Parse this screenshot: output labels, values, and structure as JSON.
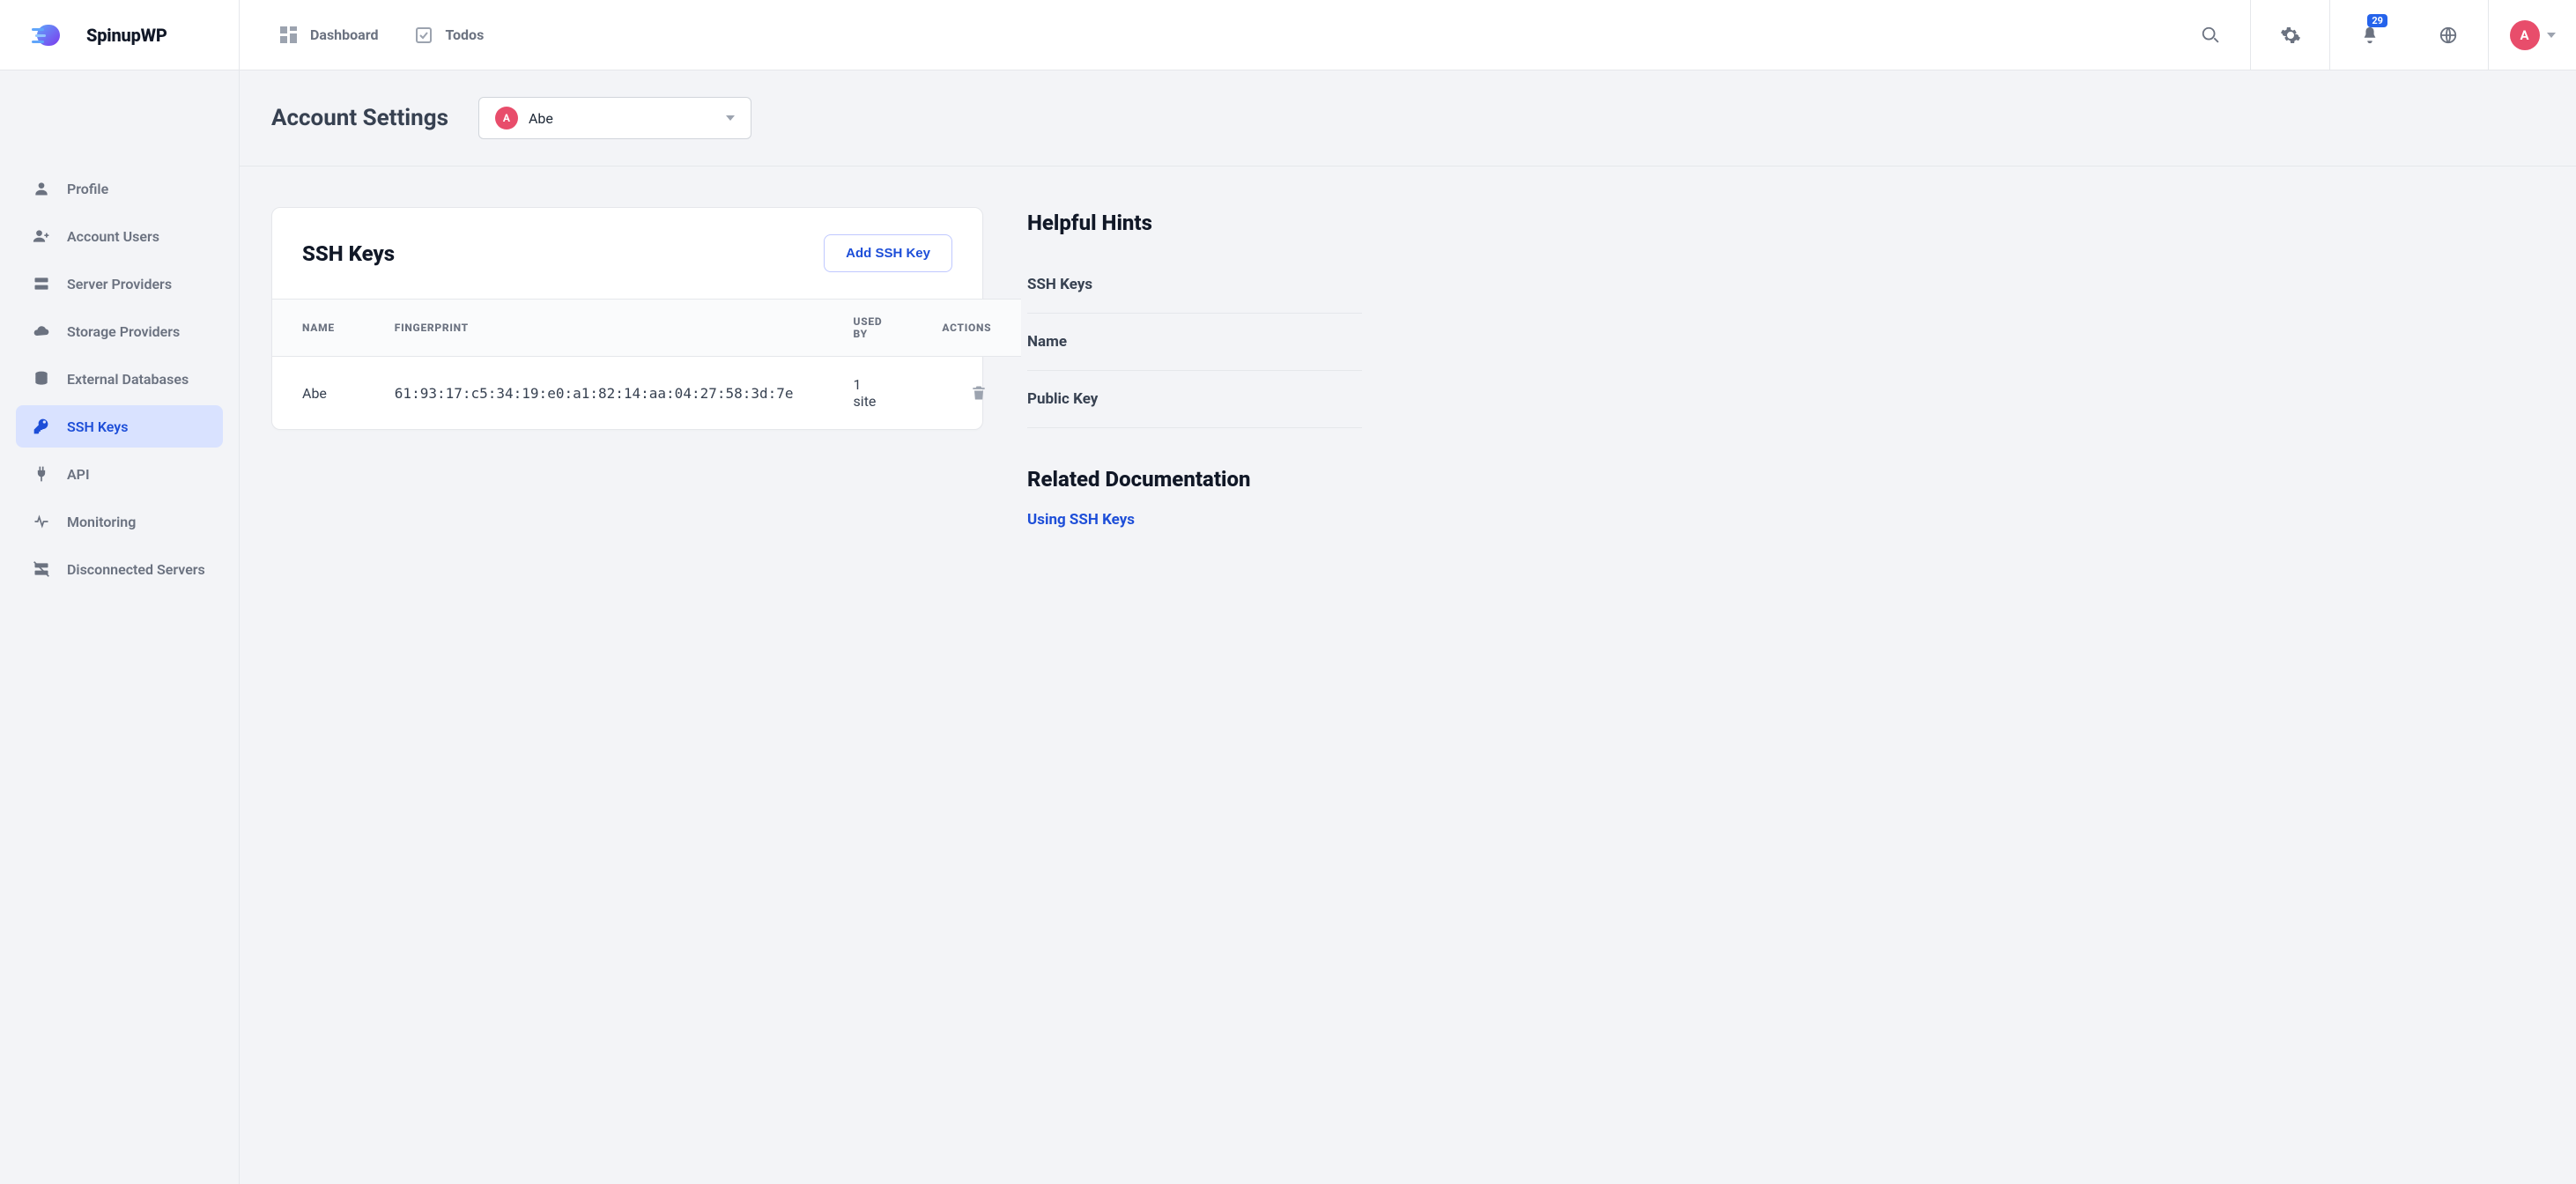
{
  "brand": {
    "name": "SpinupWP"
  },
  "topnav": {
    "dashboard": "Dashboard",
    "todos": "Todos"
  },
  "notifications": {
    "count": "29"
  },
  "user": {
    "initial": "A"
  },
  "page": {
    "title": "Account Settings",
    "account_selector": {
      "initial": "A",
      "name": "Abe"
    }
  },
  "sidebar": {
    "items": [
      {
        "id": "profile",
        "label": "Profile",
        "active": false
      },
      {
        "id": "account-users",
        "label": "Account Users",
        "active": false
      },
      {
        "id": "server-providers",
        "label": "Server Providers",
        "active": false
      },
      {
        "id": "storage-providers",
        "label": "Storage Providers",
        "active": false
      },
      {
        "id": "external-databases",
        "label": "External Databases",
        "active": false
      },
      {
        "id": "ssh-keys",
        "label": "SSH Keys",
        "active": true
      },
      {
        "id": "api",
        "label": "API",
        "active": false
      },
      {
        "id": "monitoring",
        "label": "Monitoring",
        "active": false
      },
      {
        "id": "disconnected-servers",
        "label": "Disconnected Servers",
        "active": false
      }
    ]
  },
  "card": {
    "title": "SSH Keys",
    "add_button": "Add SSH Key",
    "columns": {
      "name": "NAME",
      "fingerprint": "FINGERPRINT",
      "usedby": "USED BY",
      "actions": "ACTIONS"
    },
    "rows": [
      {
        "name": "Abe",
        "fingerprint": "61:93:17:c5:34:19:e0:a1:82:14:aa:04:27:58:3d:7e",
        "usedby": "1 site"
      }
    ]
  },
  "hints": {
    "heading": "Helpful Hints",
    "items": [
      "SSH Keys",
      "Name",
      "Public Key"
    ],
    "docs_heading": "Related Documentation",
    "docs": [
      "Using SSH Keys"
    ]
  }
}
